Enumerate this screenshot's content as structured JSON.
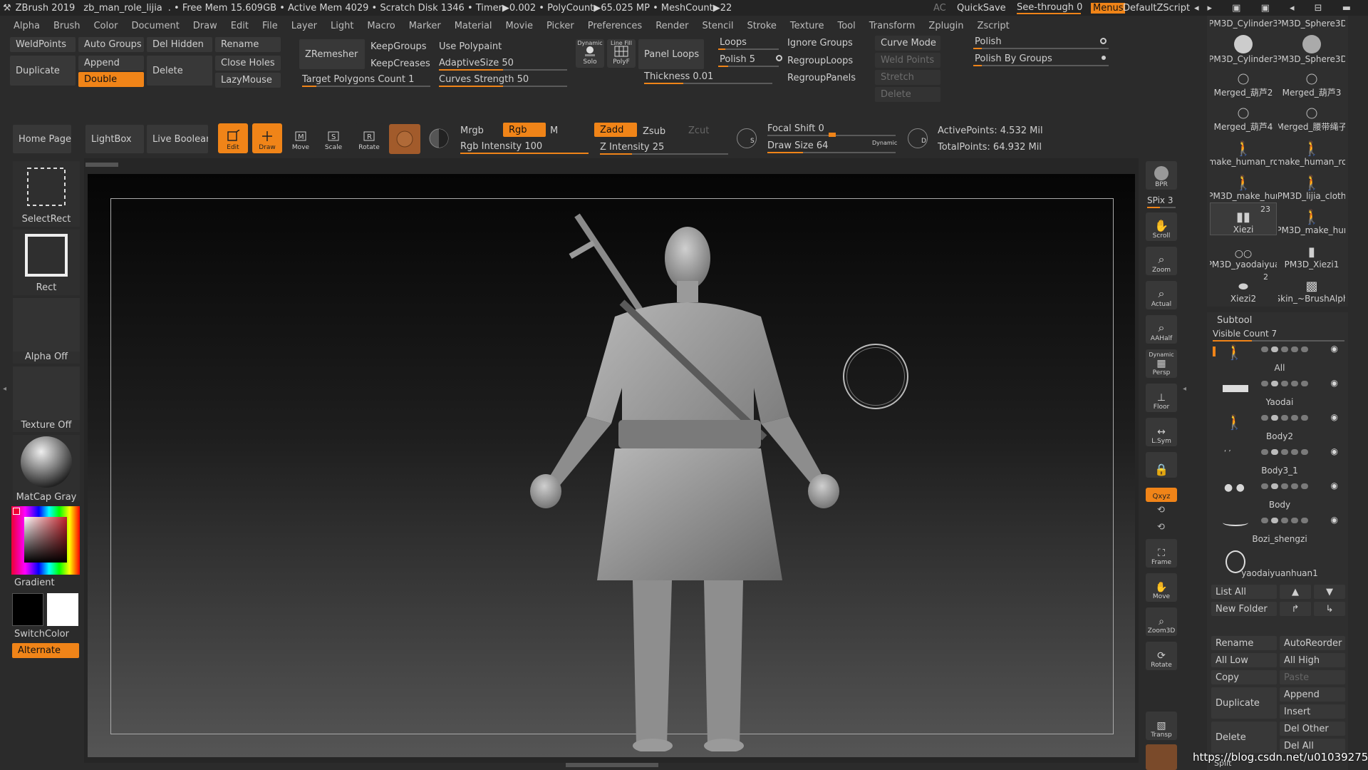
{
  "titlebar": {
    "app": "ZBrush 2019",
    "project": "zb_man_role_lijia",
    "stats": ". • Free Mem 15.609GB • Active Mem 4029 • Scratch Disk 1346 • Timer▶0.002 • PolyCount▶65.025 MP  • MeshCount▶22",
    "ac": "AC",
    "quicksave": "QuickSave",
    "seethrough": "See-through  0",
    "menus": "Menus",
    "script": "DefaultZScript"
  },
  "menubar": [
    "Alpha",
    "Brush",
    "Color",
    "Document",
    "Draw",
    "Edit",
    "File",
    "Layer",
    "Light",
    "Macro",
    "Marker",
    "Material",
    "Movie",
    "Picker",
    "Preferences",
    "Render",
    "Stencil",
    "Stroke",
    "Texture",
    "Tool",
    "Transform",
    "Zplugin",
    "Zscript"
  ],
  "shelf": {
    "weldpoints": "WeldPoints",
    "autogroups": "Auto Groups",
    "delhidden": "Del Hidden",
    "rename": "Rename",
    "duplicate": "Duplicate",
    "append": "Append",
    "delete": "Delete",
    "closeholes": "Close Holes",
    "double": "Double",
    "lazymouse": "LazyMouse",
    "zremesher": "ZRemesher",
    "keepgroups": "KeepGroups",
    "keepcreases": "KeepCreases",
    "target": "Target Polygons Count 1",
    "usepolypaint": "Use Polypaint",
    "adaptivesize": "AdaptiveSize 50",
    "curvesstrength": "Curves Strength 50",
    "dynamic": "Dynamic",
    "solo": "Solo",
    "linefill": "Line Fill",
    "polyf": "PolyF",
    "panelloops": "Panel Loops",
    "loops": "Loops",
    "polish": "Polish 5",
    "thickness": "Thickness 0.01",
    "ignoregroups": "Ignore Groups",
    "regrouploops": "RegroupLoops",
    "regrouppanels": "RegroupPanels",
    "curvemode": "Curve Mode",
    "weldpoints2": "Weld Points",
    "stretch": "Stretch",
    "delete2": "Delete",
    "polish2": "Polish",
    "polishbygroups": "Polish By Groups"
  },
  "toolbar": {
    "homepage": "Home Page",
    "lightbox": "LightBox",
    "liveboolean": "Live Boolean",
    "edit": "Edit",
    "draw": "Draw",
    "move": "Move",
    "scale": "Scale",
    "rotate": "Rotate",
    "mrgb": "Mrgb",
    "rgb": "Rgb",
    "m": "M",
    "rgbintensity": "Rgb Intensity 100",
    "zadd": "Zadd",
    "zsub": "Zsub",
    "zcut": "Zcut",
    "zintensity": "Z Intensity 25",
    "focalshift": "Focal Shift 0",
    "drawsize": "Draw Size 64",
    "dynamic": "Dynamic",
    "activepoints": "ActivePoints: 4.532 Mil",
    "totalpoints": "TotalPoints: 64.932 Mil",
    "s": "S",
    "d": "D"
  },
  "leftpanel": {
    "selectrect": "SelectRect",
    "rect": "Rect",
    "alpha": "Alpha Off",
    "texture": "Texture Off",
    "matcap": "MatCap Gray",
    "gradient": "Gradient",
    "switchcolor": "SwitchColor",
    "alternate": "Alternate"
  },
  "righticons": {
    "bpr": "BPR",
    "spix": "SPix 3",
    "scroll": "Scroll",
    "zoom": "Zoom",
    "actual": "Actual",
    "aahalf": "AAHalf",
    "dynamic": "Dynamic",
    "persp": "Persp",
    "floor": "Floor",
    "lsym": "L.Sym",
    "xyz": "Qxyz",
    "frame": "Frame",
    "move": "Move",
    "zoom3d": "Zoom3D",
    "rotate": "Rotate",
    "transp": "Transp"
  },
  "toolgrid": [
    "PM3D_Cylinder3",
    "PM3D_Sphere3D",
    "PM3D_Cylinder3",
    "PM3D_Sphere3D",
    "Merged_葫芦2",
    "Merged_葫芦3",
    "Merged_葫芦4",
    "Merged_腰带绳子",
    "make_human_ro",
    "make_human_ro",
    "PM3D_make_hur",
    "PM3D_lijia_cloth",
    "Xiezi",
    "PM3D_make_hur",
    "PM3D_yaodaiyua",
    "PM3D_Xiezi1",
    "Xiezi2",
    "Skin_~BrushAlph"
  ],
  "toolgrid_badges": {
    "xiezi": "23",
    "xiezi2": "2"
  },
  "subtool": {
    "title": "Subtool",
    "visible": "Visible Count 7",
    "items": [
      "All",
      "Yaodai",
      "Body2",
      "Body3_1",
      "Body",
      "Bozi_shengzi",
      "yaodaiyuanhuan1"
    ],
    "listall": "List All",
    "newfolder": "New Folder",
    "rename": "Rename",
    "autoreorder": "AutoReorder",
    "alllow": "All Low",
    "allhigh": "All High",
    "copy": "Copy",
    "paste": "Paste",
    "duplicate": "Duplicate",
    "append": "Append",
    "insert": "Insert",
    "delete": "Delete",
    "delother": "Del Other",
    "delall": "Del All",
    "split": "Split"
  },
  "watermark": "https://blog.csdn.net/u010392759",
  "colors": {
    "accent": "#f08418",
    "panel": "#383838",
    "bg": "#2b2b2b"
  }
}
